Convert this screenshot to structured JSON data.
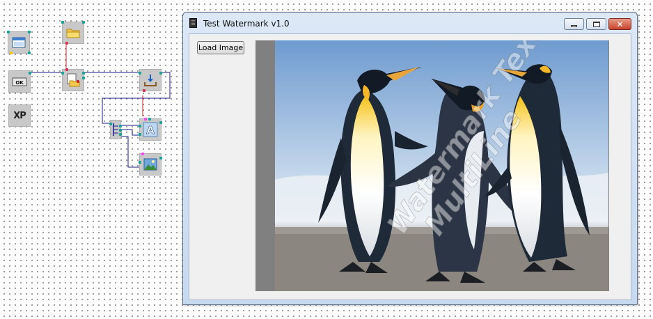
{
  "window": {
    "title": "Test Watermark v1.0",
    "close_glyph": "✕",
    "min_icon": "minimize-icon",
    "max_icon": "maximize-icon",
    "close_icon": "close-icon"
  },
  "client": {
    "load_button_label": "Load Image"
  },
  "watermark": {
    "line1": "Watermark Text",
    "line2": "MultiLine"
  },
  "canvas": {
    "nodes": [
      {
        "id": "form-window",
        "icon": "window-icon"
      },
      {
        "id": "button-ok",
        "icon": "ok-button-icon",
        "text": "OK"
      },
      {
        "id": "xp-theme",
        "icon": "xp-style-icon",
        "text": "XP"
      },
      {
        "id": "open-folder",
        "icon": "folder-icon"
      },
      {
        "id": "open-dialog",
        "icon": "open-file-dialog-icon"
      },
      {
        "id": "load-image",
        "icon": "download-tray-icon"
      },
      {
        "id": "splitter",
        "icon": "hub-splitter-icon"
      },
      {
        "id": "text-watermark",
        "icon": "text-letter-a-icon",
        "text": "A"
      },
      {
        "id": "image-display",
        "icon": "picture-icon"
      }
    ],
    "wire_colors": {
      "data": "#1a1a8c",
      "event": "#d22020"
    }
  }
}
